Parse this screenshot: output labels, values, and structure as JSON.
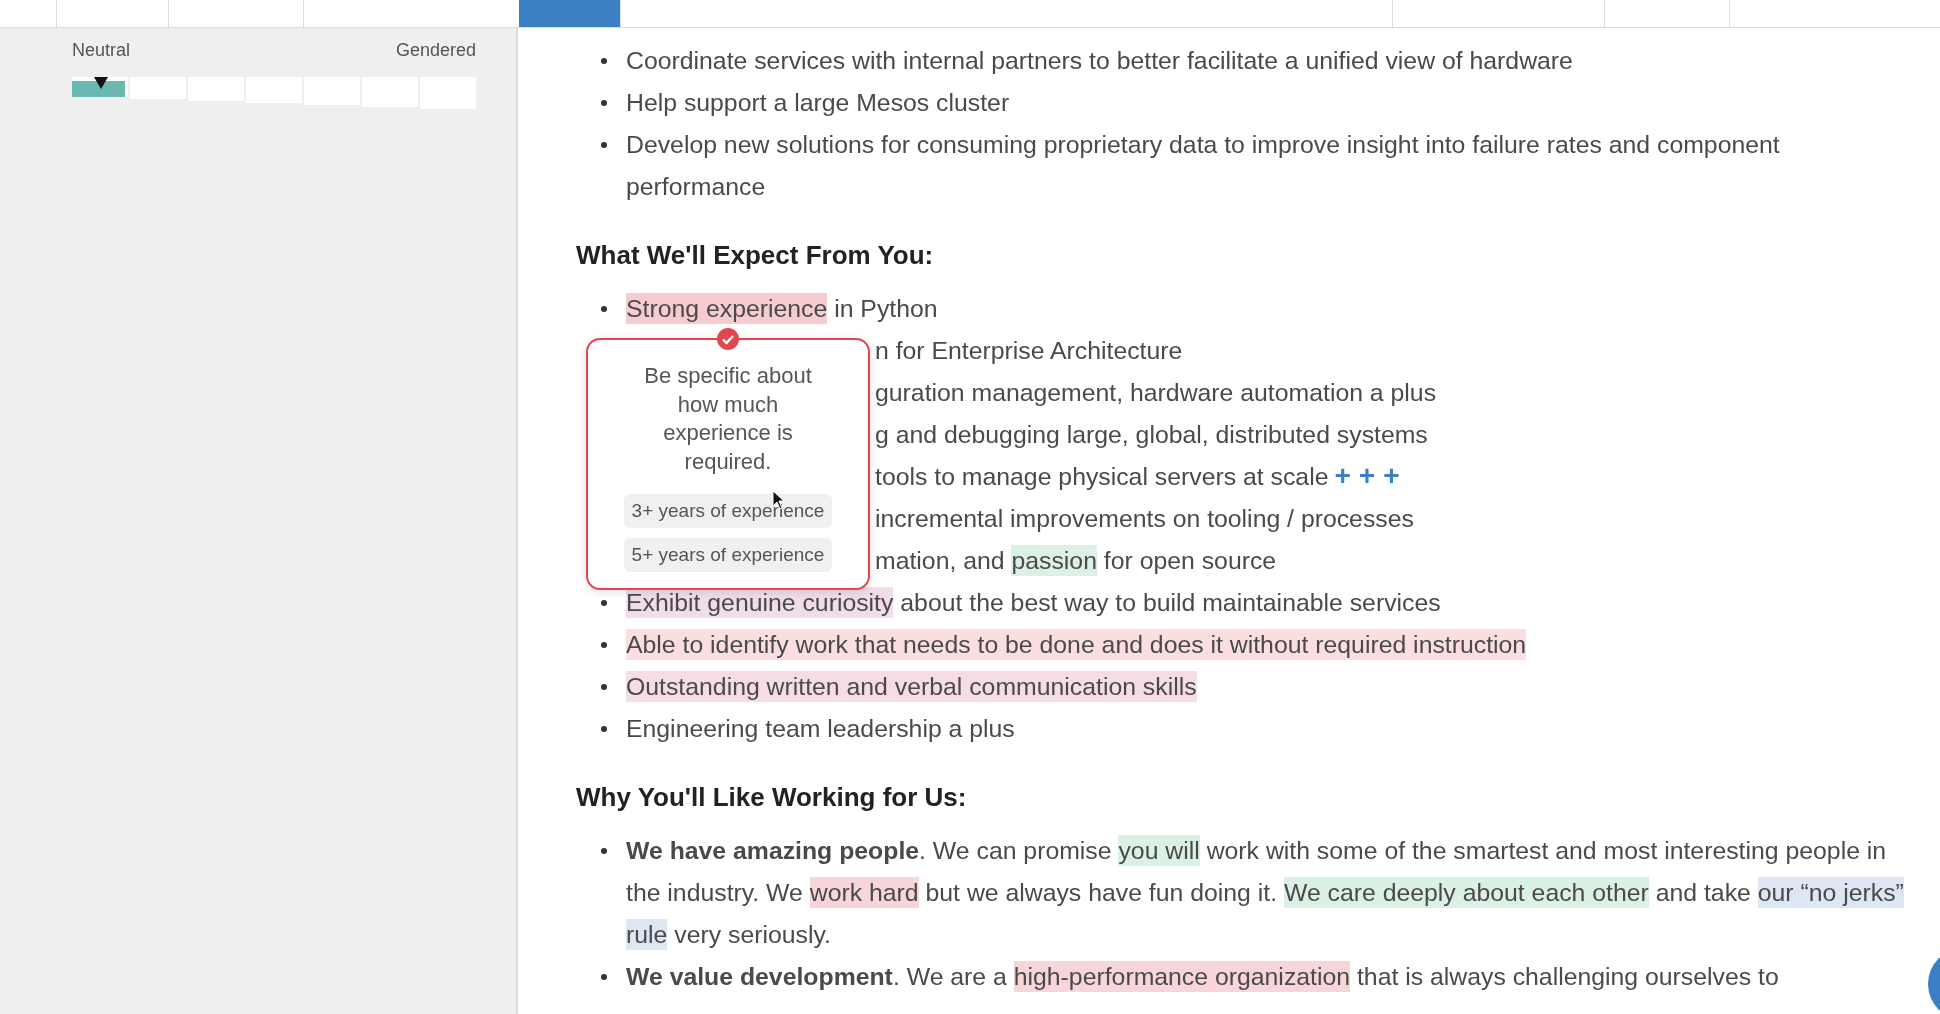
{
  "toolbar": {
    "tabs": [
      {
        "selected": true
      },
      {
        "selected": false
      }
    ]
  },
  "sidebar": {
    "tone_meter": {
      "left_label": "Neutral",
      "right_label": "Gendered"
    }
  },
  "sections": [
    {
      "items": [
        {
          "kind": "full",
          "segments": [
            {
              "text": "Coordinate services with internal partners to better facilitate a unified view of hardware"
            }
          ]
        },
        {
          "kind": "full",
          "segments": [
            {
              "text": "Help support a large Mesos cluster"
            }
          ]
        },
        {
          "kind": "full",
          "segments": [
            {
              "text": "Develop new solutions for consuming proprietary data to improve insight into failure rates and component performance"
            }
          ]
        }
      ]
    },
    {
      "heading": "What We'll Expect From You:",
      "items": [
        {
          "kind": "full",
          "segments": [
            {
              "text": "Strong experience",
              "color": "#f6ccd0"
            },
            {
              "text": " in Python"
            }
          ]
        },
        {
          "kind": "covered",
          "segments": [
            {
              "text": "n for Enterprise Architecture"
            }
          ]
        },
        {
          "kind": "covered",
          "segments": [
            {
              "text": "guration management, hardware automation a plus"
            }
          ]
        },
        {
          "kind": "covered",
          "segments": [
            {
              "text": "g and debugging large, global, distributed systems"
            }
          ]
        },
        {
          "kind": "covered",
          "segments": [
            {
              "text": "tools to manage physical servers at scale"
            }
          ],
          "actions": [
            "+",
            "+",
            "+"
          ]
        },
        {
          "kind": "covered",
          "segments": [
            {
              "text": "incremental improvements on tooling / processes"
            }
          ]
        },
        {
          "kind": "covered",
          "segments": [
            {
              "text": "mation, and "
            },
            {
              "text": "passion",
              "color": "#dcf1e6"
            },
            {
              "text": " for open source"
            }
          ]
        },
        {
          "kind": "full",
          "segments": [
            {
              "text": "Exhibit genuine curiosity",
              "color": "#f1dcea"
            },
            {
              "text": " about the best way to build maintainable services"
            }
          ]
        },
        {
          "kind": "full",
          "segments": [
            {
              "text": "Able to identify work that needs to be done and does it without required instruction",
              "color": "#fbdfe0"
            }
          ]
        },
        {
          "kind": "full",
          "segments": [
            {
              "text": "Outstanding written and verbal communication skills",
              "color": "#f6dce6"
            }
          ]
        },
        {
          "kind": "full",
          "segments": [
            {
              "text": "Engineering team leadership a plus"
            }
          ]
        }
      ]
    },
    {
      "heading": "Why You'll Like Working for Us:",
      "items": [
        {
          "kind": "full",
          "segments": [
            {
              "text": "**We have amazing people**. We can promise "
            },
            {
              "text": "you will",
              "color": "#dcf1e6"
            },
            {
              "text": " work with some of the smartest and most interesting people in the industry. We "
            },
            {
              "text": "work hard",
              "color": "#f8d5d8"
            },
            {
              "text": " but we always have fun doing it. "
            },
            {
              "text": "We care deeply about each other",
              "color": "#dcf1e6"
            },
            {
              "text": " and take "
            },
            {
              "text": "our “no jerks” rule",
              "color": "#dde6f3"
            },
            {
              "text": " very seriously."
            }
          ]
        },
        {
          "kind": "full",
          "segments": [
            {
              "text": "**We value development**. We are a "
            },
            {
              "text": "high-performance organization",
              "color": "#f8d5d8"
            },
            {
              "text": " that is always challenging ourselves to"
            }
          ]
        }
      ]
    }
  ],
  "suggestion_popup": {
    "message": "Be specific about how much experience is required.",
    "options": [
      "3+ years of experience",
      "5+ years of experience"
    ]
  }
}
